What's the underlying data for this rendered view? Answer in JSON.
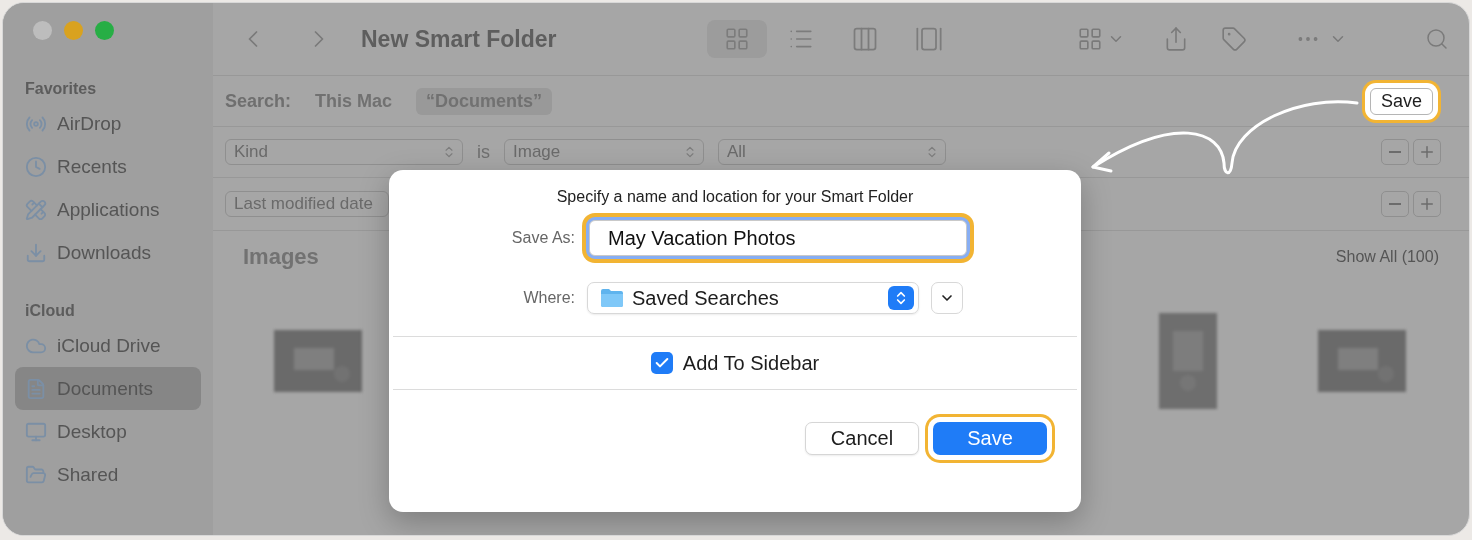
{
  "window": {
    "title": "New Smart Folder"
  },
  "sidebar": {
    "sections": [
      {
        "heading": "Favorites",
        "items": [
          {
            "label": "AirDrop",
            "selected": false
          },
          {
            "label": "Recents",
            "selected": false
          },
          {
            "label": "Applications",
            "selected": false
          },
          {
            "label": "Downloads",
            "selected": false
          }
        ]
      },
      {
        "heading": "iCloud",
        "items": [
          {
            "label": "iCloud Drive",
            "selected": false
          },
          {
            "label": "Documents",
            "selected": true
          },
          {
            "label": "Desktop",
            "selected": false
          },
          {
            "label": "Shared",
            "selected": false
          }
        ]
      }
    ]
  },
  "search_bar": {
    "label": "Search:",
    "scopes": [
      {
        "label": "This Mac",
        "selected": false
      },
      {
        "label": "“Documents”",
        "selected": true
      }
    ],
    "save_button": {
      "label": "Save",
      "highlighted": true
    }
  },
  "criteria": [
    {
      "attribute": "Kind",
      "operator": "is",
      "value": "Image",
      "detail": "All"
    },
    {
      "attribute": "Last modified date"
    }
  ],
  "results": {
    "title": "Images",
    "show_all": "Show All (100)"
  },
  "dialog": {
    "title": "Specify a name and location for your Smart Folder",
    "save_as": {
      "label": "Save As:",
      "value": "May Vacation Photos",
      "highlighted": true
    },
    "where": {
      "label": "Where:",
      "value": "Saved Searches"
    },
    "add_to_sidebar": {
      "label": "Add To Sidebar",
      "checked": true
    },
    "buttons": [
      {
        "label": "Cancel",
        "kind": "secondary",
        "highlighted": false
      },
      {
        "label": "Save",
        "kind": "primary",
        "highlighted": true
      }
    ]
  }
}
